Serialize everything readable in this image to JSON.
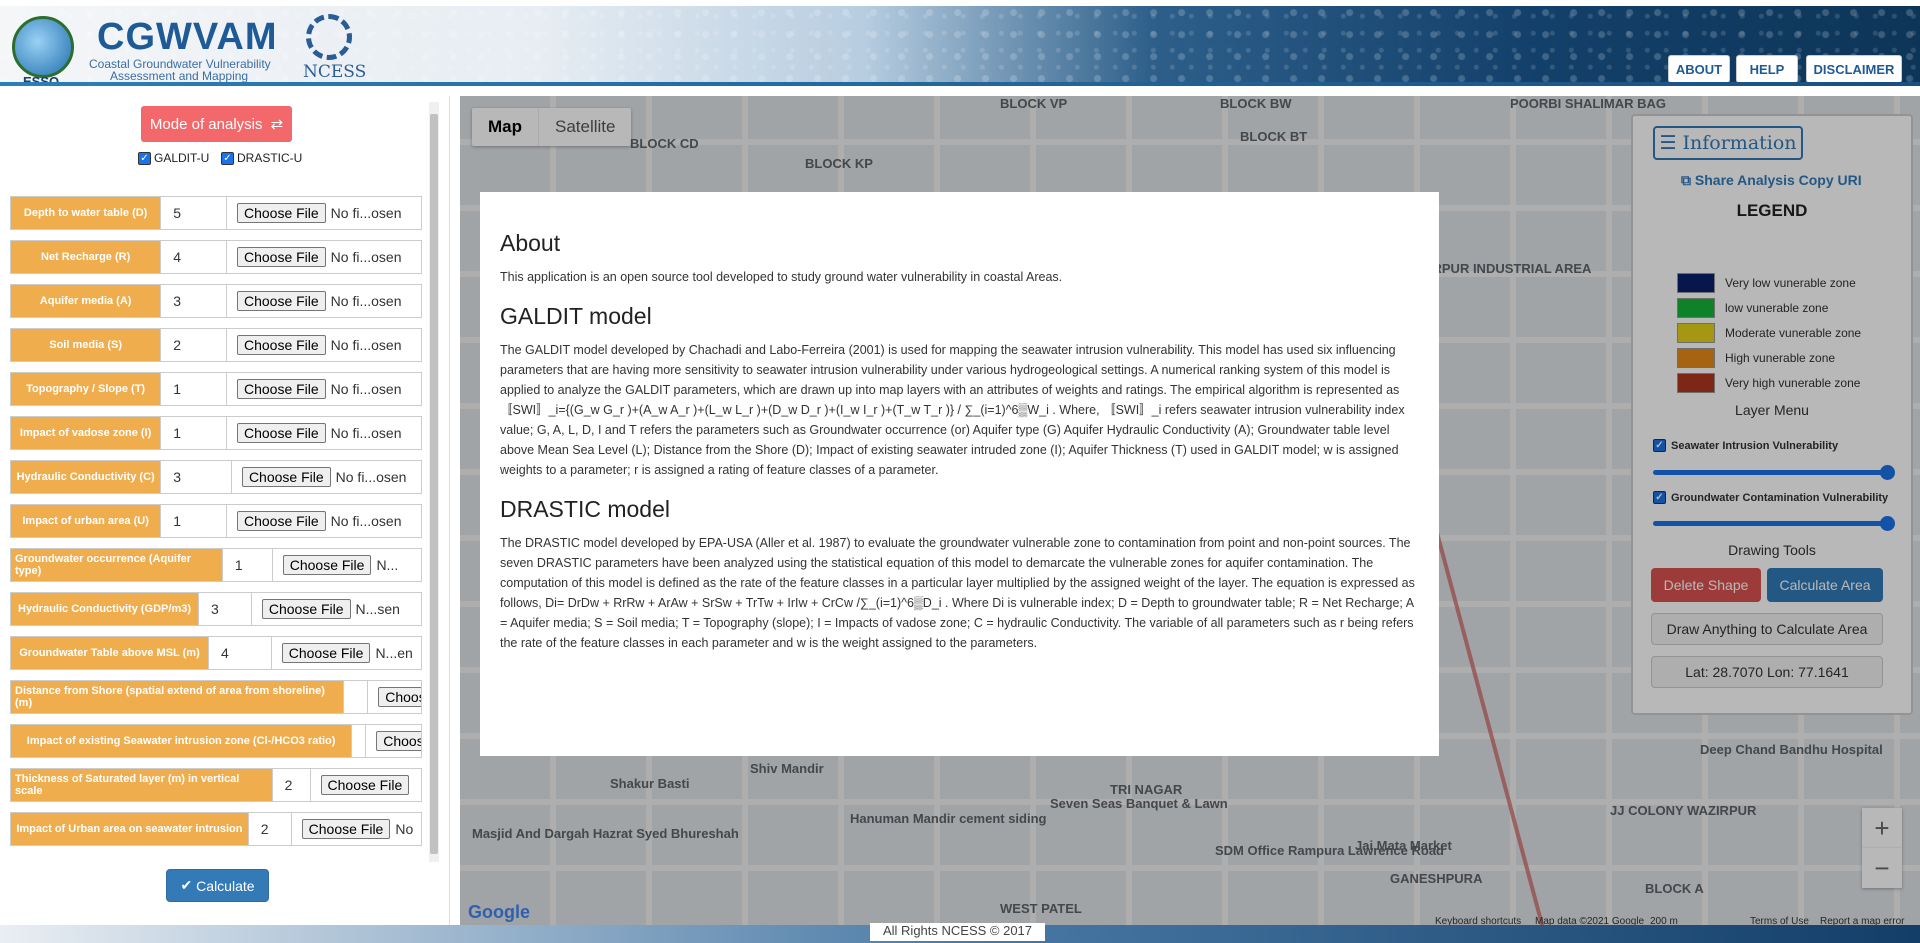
{
  "header": {
    "esso_label": "ESSO",
    "title": "CGWVAM",
    "subtitle_line1": "Coastal Groundwater Vulnerability",
    "subtitle_line2": "Assessment and Mapping",
    "ncess_label": "NCESS",
    "nav": [
      "ABOUT",
      "HELP",
      "DISCLAIMER"
    ]
  },
  "sidebar": {
    "mode_button": "Mode of analysis",
    "checkboxes": [
      "GALDIT-U",
      "DRASTIC-U"
    ],
    "choose_file_label": "Choose File",
    "params": [
      {
        "label": "Depth to water table (D)",
        "value": "5",
        "file_status": "No fi...osen"
      },
      {
        "label": "Net Recharge (R)",
        "value": "4",
        "file_status": "No fi...osen"
      },
      {
        "label": "Aquifer media (A)",
        "value": "3",
        "file_status": "No fi...osen"
      },
      {
        "label": "Soil media (S)",
        "value": "2",
        "file_status": "No fi...osen"
      },
      {
        "label": "Topography / Slope (T)",
        "value": "1",
        "file_status": "No fi...osen"
      },
      {
        "label": "Impact of vadose zone (I)",
        "value": "1",
        "file_status": "No fi...osen"
      },
      {
        "label": "Hydraulic Conductivity (C)",
        "value": "3",
        "file_status": "No fi...osen"
      },
      {
        "label": "Impact of urban area (U)",
        "value": "1",
        "file_status": "No fi...osen"
      },
      {
        "label": "Groundwater occurrence (Aquifer type)",
        "value": "1",
        "file_status": "N..."
      },
      {
        "label": "Hydraulic Conductivity (GDP/m3)",
        "value": "3",
        "file_status": "N...sen"
      },
      {
        "label": "Groundwater Table above MSL (m)",
        "value": "4",
        "file_status": "N...en"
      },
      {
        "label": "Distance from Shore (spatial extend of area from shoreline) (m)",
        "value": "",
        "file_status": ""
      },
      {
        "label": "Impact of existing Seawater intrusion zone (Cl-/HCO3 ratio)",
        "value": "",
        "file_status": ""
      },
      {
        "label": "Thickness of Saturated layer (m) in vertical scale",
        "value": "2",
        "file_status": ""
      },
      {
        "label": "Impact of Urban area on seawater intrusion",
        "value": "2",
        "file_status": "No"
      }
    ],
    "calculate": "Calculate"
  },
  "map": {
    "tabs": [
      "Map",
      "Satellite"
    ],
    "labels": [
      "BLOCK CD",
      "BLOCK KP",
      "BLOCK VP",
      "BLOCK BW",
      "BLOCK BT",
      "POORBI SHALIMAR BAG",
      "WAZIRPUR INDUSTRIAL AREA",
      "Shakur Basti",
      "Shiv Mandir",
      "TRI NAGAR",
      "WEST PATEL",
      "GANESHPURA",
      "JJ COLONY WAZIRPUR",
      "Seven Seas Banquet & Lawn",
      "SDM Office Rampura Lawrence Road",
      "Jai Mata Market",
      "Hanuman Mandir cement siding",
      "Masjid And Dargah Hazrat Syed Bhureshah",
      "Deep Chand Bandhu Hospital",
      "BLOCK A"
    ],
    "google": "Google",
    "footer_items": [
      "Keyboard shortcuts",
      "Map data ©2021 Google",
      "200 m",
      "Terms of Use",
      "Report a map error"
    ]
  },
  "info": {
    "button": "Information",
    "share": "Share Analysis Copy URI",
    "legend_title": "LEGEND",
    "legend": [
      {
        "label": "Very low vunerable zone",
        "color": "#0a1f6b"
      },
      {
        "label": "low vunerable zone",
        "color": "#16b33a"
      },
      {
        "label": "Moderate vunerable zone",
        "color": "#e6d21a"
      },
      {
        "label": "High vunerable zone",
        "color": "#e68a1a"
      },
      {
        "label": "Very high vunerable zone",
        "color": "#b1371f"
      }
    ],
    "layer_menu": "Layer Menu",
    "layers": [
      "Seawater Intrusion Vulnerability",
      "Groundwater Contamination Vulnerability"
    ],
    "drawing_tools": "Drawing Tools",
    "delete_shape": "Delete Shape",
    "calculate_area": "Calculate Area",
    "draw_anything": "Draw Anything to Calculate Area",
    "latlon": "Lat: 28.7070 Lon: 77.1641"
  },
  "modal": {
    "about_title": "About",
    "about_text": "This application is an open source tool developed to study ground water vulnerability in coastal Areas.",
    "galdit_title": "GALDIT model",
    "galdit_text": "The GALDIT model developed by Chachadi and Labo-Ferreira (2001) is used for mapping the seawater intrusion vulnerability. This model has used six influencing parameters that are having more sensitivity to seawater intrusion vulnerability under various hydrogeological settings. A numerical ranking system of this model is applied to analyze the GALDIT parameters, which are drawn up into map layers with an attributes of weights and ratings. The empirical algorithm is represented as 〚SWI〛_i={(G_w G_r )+(A_w A_r )+(L_w L_r )+(D_w D_r )+(I_w I_r )+(T_w T_r )} / ∑_(i=1)^6▒W_i . Where, 〚SWI〛_i refers seawater intrusion vulnerability index value; G, A, L, D, I and T refers the parameters such as Groundwater occurrence (or) Aquifer type (G) Aquifer Hydraulic Conductivity (A); Groundwater table level above Mean Sea Level (L); Distance from the Shore (D); Impact of existing seawater intruded zone (I); Aquifer Thickness (T) used in GALDIT model; w is assigned weights to a parameter; r is assigned a rating of feature classes of a parameter.",
    "drastic_title": "DRASTIC model",
    "drastic_text": "The DRASTIC model developed by EPA-USA (Aller et al. 1987) to evaluate the groundwater vulnerable zone to contamination from point and non-point sources. The seven DRASTIC parameters have been analyzed using the statistical equation of this model to demarcate the vulnerable zones for aquifer contamination. The computation of this model is defined as the rate of the feature classes in a particular layer multiplied by the assigned weight of the layer. The equation is expressed as follows, Di= DrDw + RrRw + ArAw + SrSw + TrTw + IrIw + CrCw /∑_(i=1)^6▒D_i . Where Di is vulnerable index; D = Depth to groundwater table; R = Net Recharge; A = Aquifer media; S = Soil media; T = Topography (slope); I = Impacts of vadose zone; C = hydraulic Conductivity. The variable of all parameters such as r being refers the rate of the feature classes in each parameter and w is the weight assigned to the parameters."
  },
  "footer": "All Rights NCESS © 2017"
}
